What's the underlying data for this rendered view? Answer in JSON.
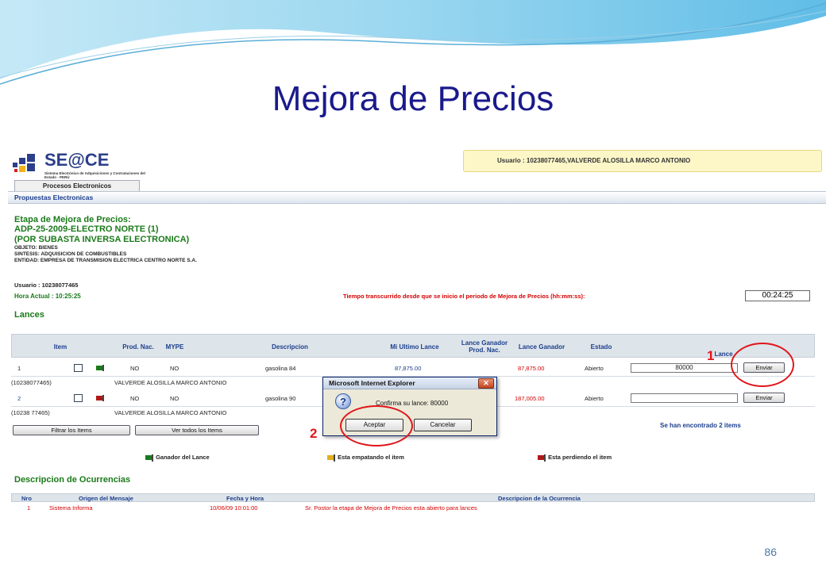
{
  "slide": {
    "title": "Mejora de Precios",
    "page_number": "86"
  },
  "app": {
    "logo_text": "SE@CE",
    "logo_subtitle": "Sistema Electrónico de Adquisiciones y Contrataciones del Estado - PERÚ",
    "user_box": "Usuario : 10238077465,VALVERDE ALOSILLA MARCO ANTONIO",
    "main_tab": "Procesos Electronicos",
    "nav_link": "Propuestas Electronicas"
  },
  "header": {
    "etapa": "Etapa de Mejora de Precios:",
    "proceso": "ADP-25-2009-ELECTRO NORTE (1)",
    "modalidad": "(POR SUBASTA INVERSA ELECTRONICA)",
    "objeto": "OBJETO: BIENES",
    "sintesis": "SINTESIS: ADQUISICION DE COMBUSTIBLES",
    "entidad": "ENTIDAD: EMPRESA DE TRANSMISION ELECTRICA CENTRO NORTE S.A.",
    "usuario": "Usuario : 10238077465",
    "hora_actual": "Hora Actual : 10:25:25",
    "tiempo_label": "Tiempo transcurrido desde que se inicio el periodo de Mejora de Precios (hh:mm:ss):",
    "tiempo_value": "00:24:25"
  },
  "lances": {
    "title": "Lances",
    "columns": {
      "item": "Item",
      "prod_nac": "Prod. Nac.",
      "mype": "MYPE",
      "descripcion": "Descripcion",
      "mi_ultimo": "Mi Ultimo Lance",
      "ganador_prod": "Lance Ganador Prod. Nac.",
      "ganador": "Lance Ganador",
      "estado": "Estado",
      "lance": "Lance"
    },
    "rows": [
      {
        "item": "1",
        "prod_nac": "NO",
        "mype": "NO",
        "descripcion": "gasolina 84",
        "mi_ultimo": "87,875.00",
        "ganador_prod": "",
        "ganador": "87,875.00",
        "estado": "Abierto",
        "lance_input": "80000",
        "enviar": "Enviar",
        "postor": "(10238077465)",
        "postor_nombre": "VALVERDE ALOSILLA MARCO ANTONIO"
      },
      {
        "item": "2",
        "prod_nac": "NO",
        "mype": "NO",
        "descripcion": "gasolina 90",
        "mi_ultimo": "",
        "ganador_prod": "",
        "ganador": "187,005.00",
        "estado": "Abierto",
        "lance_input": "",
        "enviar": "Enviar",
        "postor": "(10238 77465)",
        "postor_nombre": "VALVERDE ALOSILLA MARCO ANTONIO"
      }
    ],
    "filter_button": "Filtrar los Items",
    "view_all_button": "Ver todos los Items",
    "found_message": "Se han encontrado 2 items",
    "legend": {
      "ganador": "Ganador del Lance",
      "empatando": "Esta empatando el item",
      "perdiendo": "Esta perdiendo el item"
    }
  },
  "ocurrencias": {
    "title": "Descripcion de Ocurrencias",
    "columns": {
      "nro": "Nro",
      "origen": "Origen del Mensaje",
      "fecha": "Fecha y Hora",
      "descripcion": "Descripcion de la Ocurrencia"
    },
    "rows": [
      {
        "nro": "1",
        "origen": "Sistema Informa",
        "fecha": "10/06/09 10:01:00",
        "descripcion": "Sr. Postor la etapa de Mejora de Precios esta abierto para lances"
      }
    ]
  },
  "dialog": {
    "title": "Microsoft Internet Explorer",
    "close_glyph": "✕",
    "icon_glyph": "?",
    "message": "Confirma su lance: 80000",
    "accept": "Aceptar",
    "cancel": "Cancelar"
  },
  "callouts": {
    "one": "1",
    "two": "2",
    "color": "#e0161b"
  },
  "colors": {
    "title": "#1a1a8c",
    "green_heading": "#1a7a1a",
    "link_blue": "#1c3e8c",
    "alert_red": "#d40000"
  }
}
